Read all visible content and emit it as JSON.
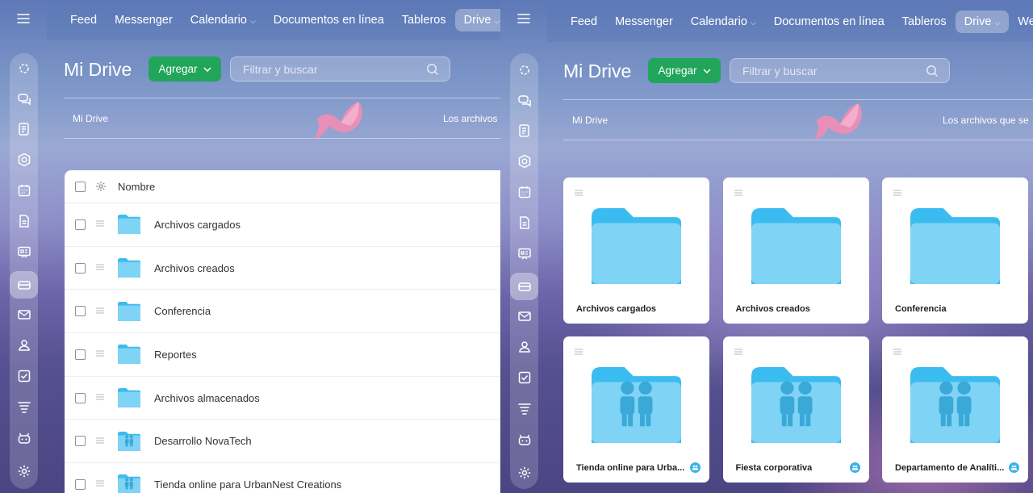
{
  "app": {
    "title": "Mi Drive",
    "add_button": "Agregar",
    "search_placeholder": "Filtrar y buscar",
    "breadcrumb": "Mi Drive"
  },
  "left_panel": {
    "nav": [
      "Feed",
      "Messenger",
      "Calendario",
      "Documentos en línea",
      "Tableros",
      "Drive"
    ],
    "breadcrumb_right": "Los archivos",
    "list_header": "Nombre",
    "items": [
      {
        "name": "Archivos cargados",
        "icon": "folder-icon"
      },
      {
        "name": "Archivos creados",
        "icon": "folder-icon"
      },
      {
        "name": "Conferencia",
        "icon": "folder-icon"
      },
      {
        "name": "Reportes",
        "icon": "folder-icon"
      },
      {
        "name": "Archivos almacenados",
        "icon": "folder-icon"
      },
      {
        "name": "Desarrollo NovaTech",
        "icon": "shared-folder-icon"
      },
      {
        "name": "Tienda online para UrbanNest Creations",
        "icon": "shared-folder-icon"
      }
    ]
  },
  "right_panel": {
    "nav": [
      "Feed",
      "Messenger",
      "Calendario",
      "Documentos en línea",
      "Tableros",
      "Drive",
      "Webr"
    ],
    "breadcrumb_right": "Los archivos que se",
    "tiles": [
      {
        "name": "Archivos cargados",
        "icon": "folder-icon"
      },
      {
        "name": "Archivos creados",
        "icon": "folder-icon"
      },
      {
        "name": "Conferencia",
        "icon": "folder-icon"
      },
      {
        "name": "Tienda online para Urba...",
        "icon": "shared-folder-icon"
      },
      {
        "name": "Fiesta corporativa",
        "icon": "shared-folder-icon"
      },
      {
        "name": "Departamento de Analíti...",
        "icon": "shared-folder-icon"
      }
    ]
  },
  "sidebar_icons": [
    "menu-icon",
    "feed-icon",
    "chat-icon",
    "document-icon",
    "hexagon-icon",
    "calendar-icon",
    "doc-file-icon",
    "board-icon",
    "drive-icon",
    "mail-icon",
    "contacts-icon",
    "tasks-icon",
    "stack-icon",
    "bot-icon",
    "settings-icon"
  ],
  "colors": {
    "accent_green": "#21a55a",
    "folder_blue": "#7fd3f5",
    "folder_tab": "#3bbcf0",
    "badge_blue": "#3bb3ea"
  }
}
